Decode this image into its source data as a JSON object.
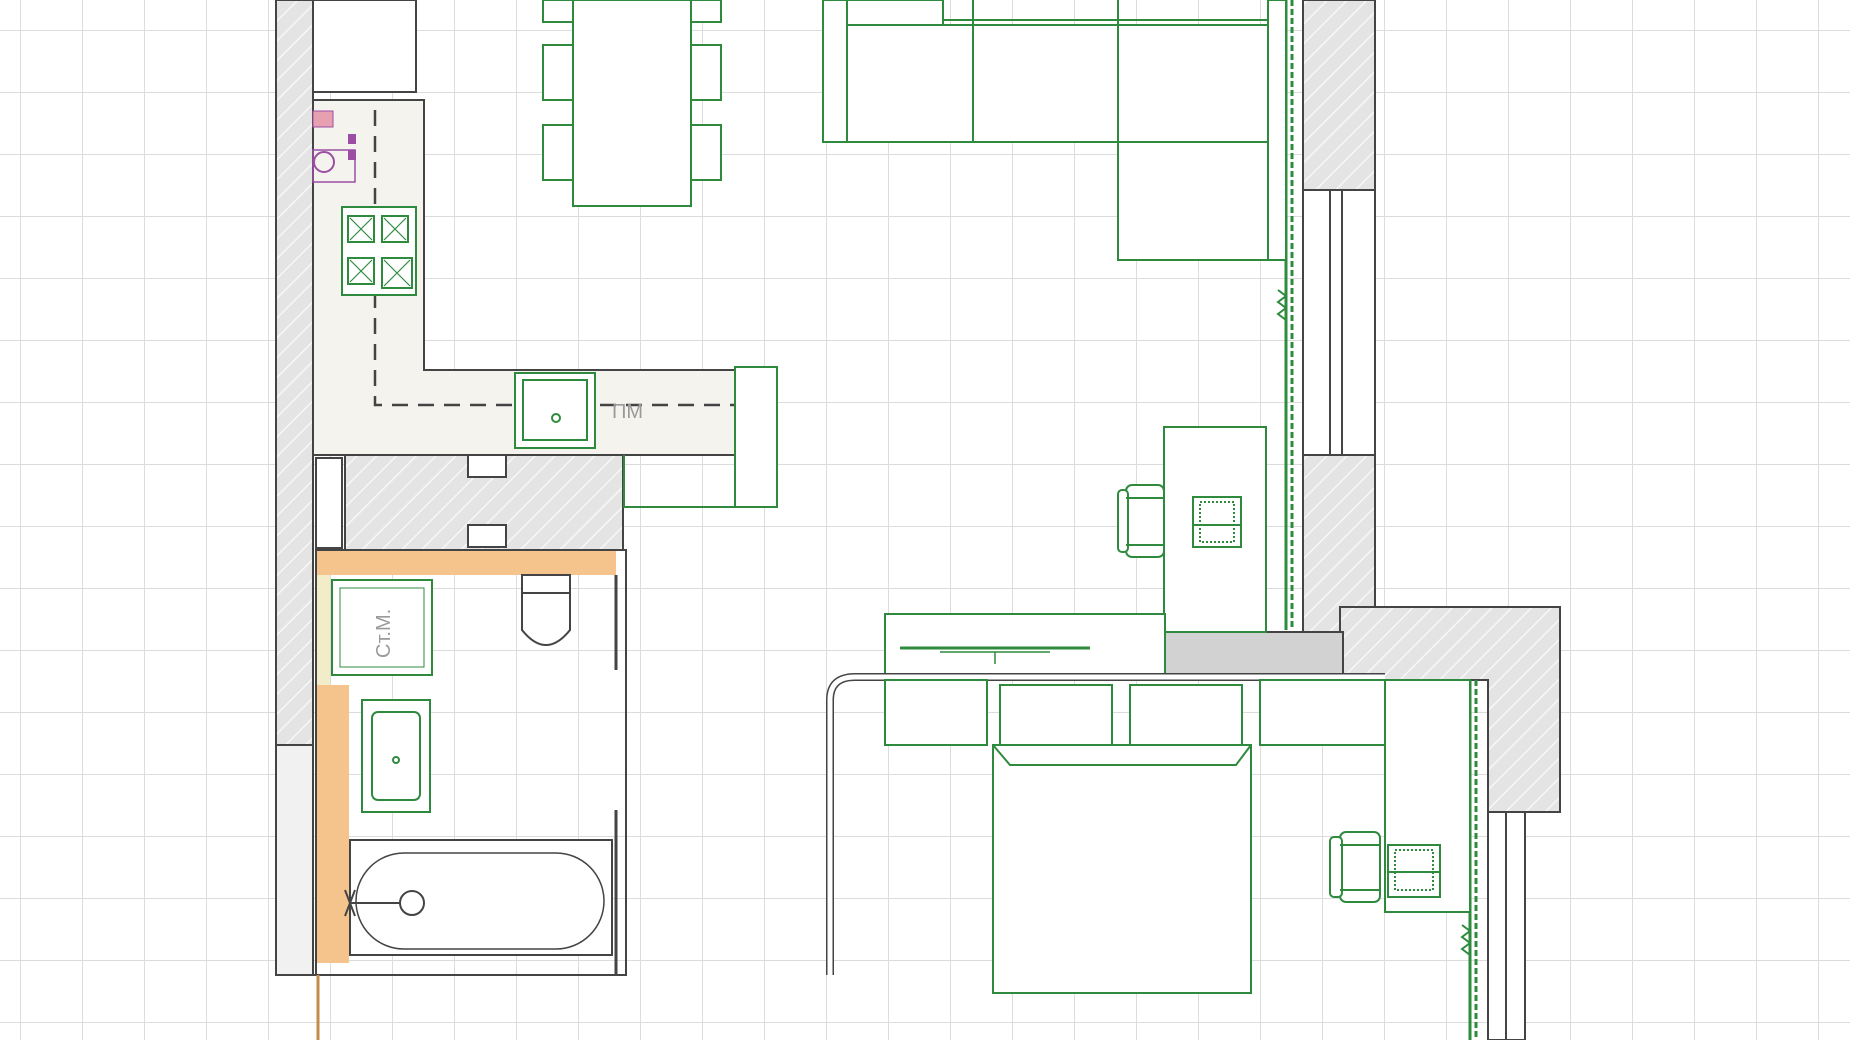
{
  "labels": {
    "dishwasher": "ПМ",
    "washing_machine": "Ст.М."
  },
  "colors": {
    "background": "#ffffff",
    "grid": "#dcdcdc",
    "wall_fill": "#e4e4e4",
    "wall_stroke": "#444444",
    "furniture": "#2e8b3e",
    "kitchen_floor": "#f4f3ee",
    "tile_accent": "#f5c48c",
    "appliance_accent": "#9b4ea3",
    "text_gray": "#9a9a9a"
  },
  "icons": [
    "laptop-icon",
    "office-chair-icon",
    "faucet-icon",
    "gas-stove-icon",
    "toilet-icon",
    "sink-icon",
    "boiler-icon",
    "tv-icon"
  ]
}
